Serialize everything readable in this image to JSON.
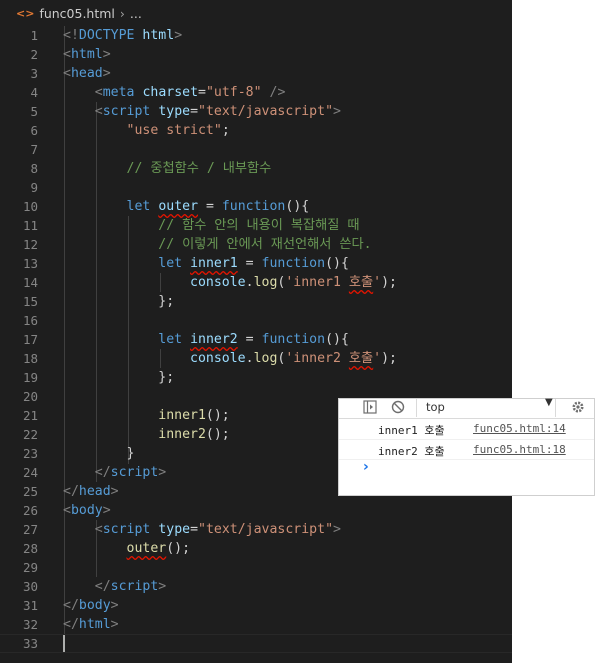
{
  "breadcrumb": {
    "file": "func05.html",
    "rest": "..."
  },
  "editor": {
    "lines": [
      [
        [
          "t-punc",
          "<!"
        ],
        [
          "t-dt",
          "DOCTYPE"
        ],
        [
          "t-txt",
          " "
        ],
        [
          "t-attr",
          "html"
        ],
        [
          "t-punc",
          ">"
        ]
      ],
      [
        [
          "t-punc",
          "<"
        ],
        [
          "t-tag",
          "html"
        ],
        [
          "t-punc",
          ">"
        ]
      ],
      [
        [
          "t-punc",
          "<"
        ],
        [
          "t-tag",
          "head"
        ],
        [
          "t-punc",
          ">"
        ]
      ],
      [
        [
          "t-txt",
          "    "
        ],
        [
          "t-punc",
          "<"
        ],
        [
          "t-tag",
          "meta"
        ],
        [
          "t-txt",
          " "
        ],
        [
          "t-attr",
          "charset"
        ],
        [
          "t-txt",
          "="
        ],
        [
          "t-str",
          "\"utf-8\""
        ],
        [
          "t-txt",
          " "
        ],
        [
          "t-punc",
          "/>"
        ]
      ],
      [
        [
          "t-txt",
          "    "
        ],
        [
          "t-punc",
          "<"
        ],
        [
          "t-tag",
          "script"
        ],
        [
          "t-txt",
          " "
        ],
        [
          "t-attr",
          "type"
        ],
        [
          "t-txt",
          "="
        ],
        [
          "t-str",
          "\"text/javascript\""
        ],
        [
          "t-punc",
          ">"
        ]
      ],
      [
        [
          "t-txt",
          "        "
        ],
        [
          "t-str",
          "\"use strict\""
        ],
        [
          "t-txt",
          ";"
        ]
      ],
      [],
      [
        [
          "t-txt",
          "        "
        ],
        [
          "t-cmt",
          "// 중첩함수 / 내부함수"
        ]
      ],
      [],
      [
        [
          "t-txt",
          "        "
        ],
        [
          "t-kw",
          "let"
        ],
        [
          "t-txt",
          " "
        ],
        [
          "t-var sq",
          "outer"
        ],
        [
          "t-txt",
          " = "
        ],
        [
          "t-kw",
          "function"
        ],
        [
          "t-txt",
          "(){"
        ]
      ],
      [
        [
          "t-txt",
          "            "
        ],
        [
          "t-cmt",
          "// 함수 안의 내용이 복잡해질 때"
        ]
      ],
      [
        [
          "t-txt",
          "            "
        ],
        [
          "t-cmt",
          "// 이렇게 안에서 재선언해서 쓴다."
        ]
      ],
      [
        [
          "t-txt",
          "            "
        ],
        [
          "t-kw",
          "let"
        ],
        [
          "t-txt",
          " "
        ],
        [
          "t-var sq",
          "inner1"
        ],
        [
          "t-txt",
          " = "
        ],
        [
          "t-kw",
          "function"
        ],
        [
          "t-txt",
          "(){"
        ]
      ],
      [
        [
          "t-txt",
          "                "
        ],
        [
          "t-var",
          "console"
        ],
        [
          "t-txt",
          "."
        ],
        [
          "t-fn",
          "log"
        ],
        [
          "t-txt",
          "("
        ],
        [
          "t-str",
          "'inner1 "
        ],
        [
          "t-str sq",
          "호출"
        ],
        [
          "t-str",
          "'"
        ],
        [
          "t-txt",
          ");"
        ]
      ],
      [
        [
          "t-txt",
          "            };"
        ]
      ],
      [],
      [
        [
          "t-txt",
          "            "
        ],
        [
          "t-kw",
          "let"
        ],
        [
          "t-txt",
          " "
        ],
        [
          "t-var sq",
          "inner2"
        ],
        [
          "t-txt",
          " = "
        ],
        [
          "t-kw",
          "function"
        ],
        [
          "t-txt",
          "(){"
        ]
      ],
      [
        [
          "t-txt",
          "                "
        ],
        [
          "t-var",
          "console"
        ],
        [
          "t-txt",
          "."
        ],
        [
          "t-fn",
          "log"
        ],
        [
          "t-txt",
          "("
        ],
        [
          "t-str",
          "'inner2 "
        ],
        [
          "t-str sq",
          "호출"
        ],
        [
          "t-str",
          "'"
        ],
        [
          "t-txt",
          ");"
        ]
      ],
      [
        [
          "t-txt",
          "            };"
        ]
      ],
      [],
      [
        [
          "t-txt",
          "            "
        ],
        [
          "t-fn",
          "inner1"
        ],
        [
          "t-txt",
          "();"
        ]
      ],
      [
        [
          "t-txt",
          "            "
        ],
        [
          "t-fn",
          "inner2"
        ],
        [
          "t-txt",
          "();"
        ]
      ],
      [
        [
          "t-txt",
          "        }"
        ]
      ],
      [
        [
          "t-txt",
          "    "
        ],
        [
          "t-punc",
          "</"
        ],
        [
          "t-tag",
          "script"
        ],
        [
          "t-punc",
          ">"
        ]
      ],
      [
        [
          "t-punc",
          "</"
        ],
        [
          "t-tag",
          "head"
        ],
        [
          "t-punc",
          ">"
        ]
      ],
      [
        [
          "t-punc",
          "<"
        ],
        [
          "t-tag",
          "body"
        ],
        [
          "t-punc",
          ">"
        ]
      ],
      [
        [
          "t-txt",
          "    "
        ],
        [
          "t-punc",
          "<"
        ],
        [
          "t-tag",
          "script"
        ],
        [
          "t-txt",
          " "
        ],
        [
          "t-attr",
          "type"
        ],
        [
          "t-txt",
          "="
        ],
        [
          "t-str",
          "\"text/javascript\""
        ],
        [
          "t-punc",
          ">"
        ]
      ],
      [
        [
          "t-txt",
          "        "
        ],
        [
          "t-fn sq",
          "outer"
        ],
        [
          "t-txt",
          "();"
        ]
      ],
      [],
      [
        [
          "t-txt",
          "    "
        ],
        [
          "t-punc",
          "</"
        ],
        [
          "t-tag",
          "script"
        ],
        [
          "t-punc",
          ">"
        ]
      ],
      [
        [
          "t-punc",
          "</"
        ],
        [
          "t-tag",
          "body"
        ],
        [
          "t-punc",
          ">"
        ]
      ],
      [
        [
          "t-punc",
          "</"
        ],
        [
          "t-tag",
          "html"
        ],
        [
          "t-punc",
          ">"
        ]
      ],
      []
    ]
  },
  "console": {
    "filter_value": "top",
    "messages": [
      {
        "text": "inner1 호출",
        "source": "func05.html:14"
      },
      {
        "text": "inner2 호출",
        "source": "func05.html:18"
      }
    ],
    "prompt": "›"
  }
}
